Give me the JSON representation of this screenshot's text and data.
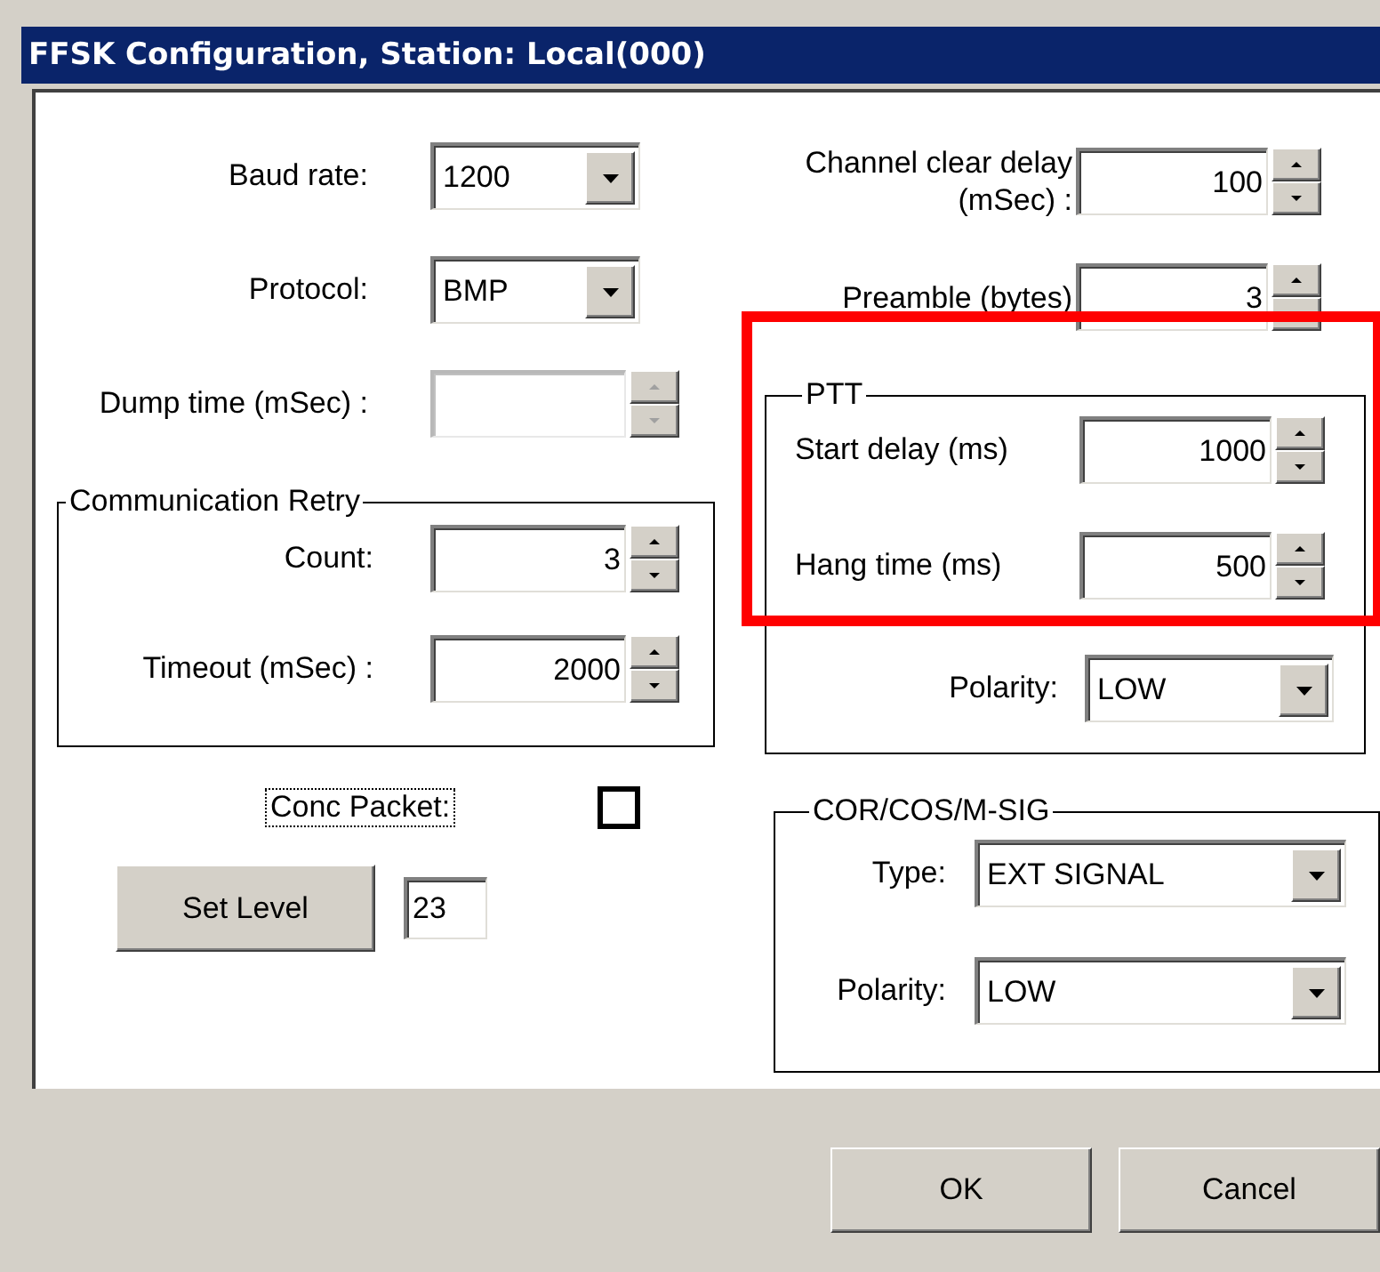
{
  "window": {
    "title": "FFSK Configuration, Station: Local(000)"
  },
  "left_fields": [
    {
      "kind": "combo",
      "label": "Baud rate:",
      "value": "1200",
      "disabled": false
    },
    {
      "kind": "combo",
      "label": "Protocol:",
      "value": "BMP",
      "disabled": false
    },
    {
      "kind": "spin",
      "label": "Dump time (mSec) :",
      "disabled": true
    }
  ],
  "communication_retry": {
    "title": "Communication Retry",
    "fields": [
      {
        "label": "Count:",
        "value": "3"
      },
      {
        "label": "Timeout (mSec) :",
        "value": "2000"
      }
    ]
  },
  "conc_packet": {
    "label": "Conc Packet:",
    "focused": true,
    "checked": false
  },
  "set_level": {
    "button": "Set Level",
    "value": "23"
  },
  "right_fields": [
    {
      "label": "Channel clear delay (mSec) :",
      "value": "100"
    },
    {
      "label": "Preamble (bytes)",
      "value": "3"
    }
  ],
  "ptt": {
    "title": "PTT",
    "fields": [
      {
        "label": "Start delay (ms)",
        "value": "1000"
      },
      {
        "label": "Hang time (ms)",
        "value": "500"
      }
    ],
    "polarity": {
      "label": "Polarity:",
      "value": "LOW"
    }
  },
  "cor": {
    "title": "COR/COS/M-SIG",
    "fields": [
      {
        "label": "Type:",
        "value": "EXT SIGNAL"
      },
      {
        "label": "Polarity:",
        "value": "LOW"
      }
    ]
  },
  "buttons": [
    "OK",
    "Cancel"
  ]
}
